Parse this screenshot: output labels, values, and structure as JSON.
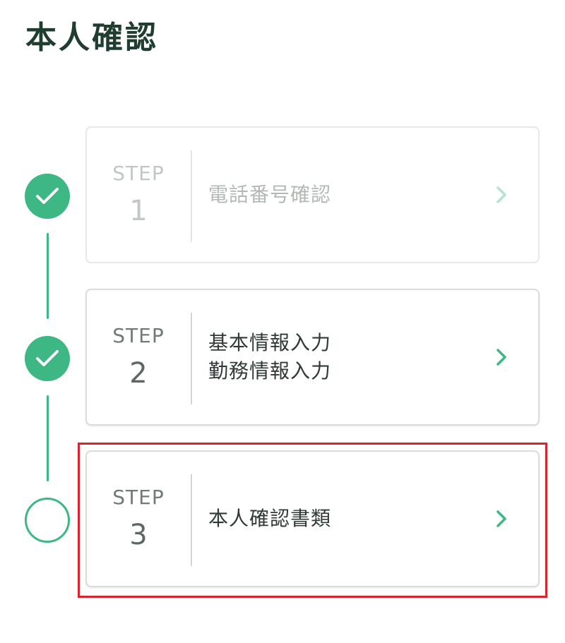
{
  "page": {
    "title": "本人確認"
  },
  "steps": [
    {
      "word": "STEP",
      "number": "1",
      "lines": [
        "電話番号確認"
      ],
      "status": "completed",
      "status_icon": "check-icon",
      "chevron_color": "#b5e3cd"
    },
    {
      "word": "STEP",
      "number": "2",
      "lines": [
        "基本情報入力",
        "勤務情報入力"
      ],
      "status": "completed",
      "status_icon": "check-icon",
      "chevron_color": "#3db784"
    },
    {
      "word": "STEP",
      "number": "3",
      "lines": [
        "本人確認書類"
      ],
      "status": "pending",
      "status_icon": "empty-circle-icon",
      "chevron_color": "#3db784",
      "highlighted": true
    }
  ],
  "colors": {
    "accent": "#3db784",
    "title": "#1f3d30",
    "highlight": "#d8242e"
  }
}
